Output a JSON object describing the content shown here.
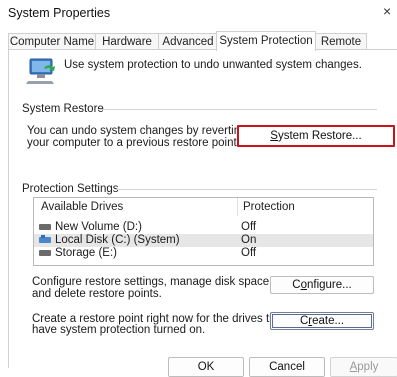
{
  "window": {
    "title": "System Properties",
    "close_glyph": "×"
  },
  "tabs": [
    {
      "label": "Computer Name"
    },
    {
      "label": "Hardware"
    },
    {
      "label": "Advanced"
    },
    {
      "label": "System Protection",
      "active": true
    },
    {
      "label": "Remote"
    }
  ],
  "intro": {
    "text": "Use system protection to undo unwanted system changes.",
    "icon": "computer-shield-icon"
  },
  "system_restore": {
    "heading": "System Restore",
    "description_line1": "You can undo system changes by reverting",
    "description_line2": "your computer to a previous restore point.",
    "button_label": "System Restore..."
  },
  "protection": {
    "heading": "Protection Settings",
    "columns": [
      "Available Drives",
      "Protection"
    ],
    "drives": [
      {
        "name": "New Volume (D:)",
        "protection": "Off",
        "icon": "drive-icon",
        "selected": false
      },
      {
        "name": "Local Disk (C:) (System)",
        "protection": "On",
        "icon": "system-drive-icon",
        "selected": true
      },
      {
        "name": "Storage (E:)",
        "protection": "Off",
        "icon": "drive-icon",
        "selected": false
      }
    ],
    "configure_line1": "Configure restore settings, manage disk space,",
    "configure_line2": "and delete restore points.",
    "configure_button": "Configure...",
    "create_line1": "Create a restore point right now for the drives that",
    "create_line2": "have system protection turned on.",
    "create_button": "Create..."
  },
  "footer": {
    "ok": "OK",
    "cancel": "Cancel",
    "apply": "Apply"
  },
  "colors": {
    "highlight_border": "#c8141a",
    "selected_row": "#e6e6e6"
  }
}
